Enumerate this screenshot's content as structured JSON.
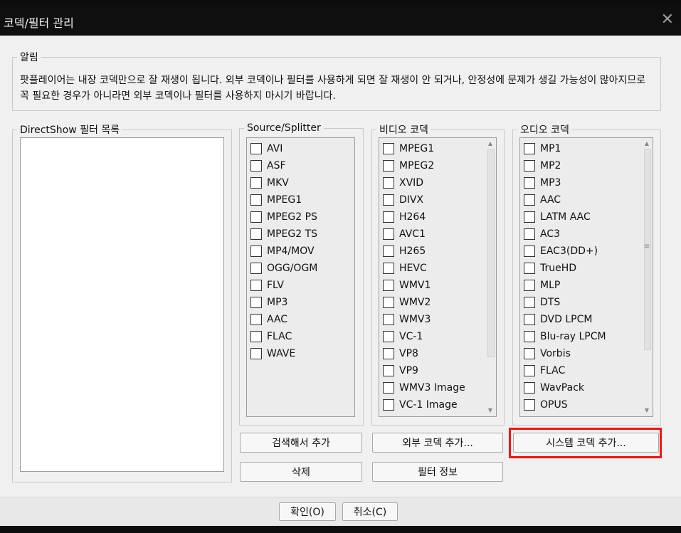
{
  "window": {
    "title": "코덱/필터 관리",
    "close_glyph": "✕"
  },
  "notice": {
    "legend": "알림",
    "text": "팟플레이어는 내장 코덱만으로 잘 재생이 됩니다. 외부 코덱이나 필터를 사용하게 되면 잘 재생이 안 되거나, 안정성에 문제가 생길 가능성이 많아지므로 꼭 필요한 경우가 아니라면 외부 코덱이나 필터를 사용하지 마시기 바랍니다."
  },
  "directshow": {
    "legend": "DirectShow 필터 목록"
  },
  "source": {
    "legend": "Source/Splitter",
    "items": [
      "AVI",
      "ASF",
      "MKV",
      "MPEG1",
      "MPEG2 PS",
      "MPEG2 TS",
      "MP4/MOV",
      "OGG/OGM",
      "FLV",
      "MP3",
      "AAC",
      "FLAC",
      "WAVE"
    ]
  },
  "video": {
    "legend": "비디오 코덱",
    "items": [
      "MPEG1",
      "MPEG2",
      "XVID",
      "DIVX",
      "H264",
      "AVC1",
      "H265",
      "HEVC",
      "WMV1",
      "WMV2",
      "WMV3",
      "VC-1",
      "VP8",
      "VP9",
      "WMV3 Image",
      "VC-1 Image"
    ]
  },
  "audio": {
    "legend": "오디오 코덱",
    "items": [
      "MP1",
      "MP2",
      "MP3",
      "AAC",
      "LATM AAC",
      "AC3",
      "EAC3(DD+)",
      "TrueHD",
      "MLP",
      "DTS",
      "DVD LPCM",
      "Blu-ray LPCM",
      "Vorbis",
      "FLAC",
      "WavPack",
      "OPUS"
    ]
  },
  "buttons": {
    "search_add": "검색해서 추가",
    "external_add": "외부 코덱 추가...",
    "system_add": "시스템 코덱 추가...",
    "delete": "삭제",
    "filter_info": "필터 정보",
    "ok": "확인(O)",
    "cancel": "취소(C)"
  },
  "accent": {
    "highlight": "#ff1010"
  }
}
